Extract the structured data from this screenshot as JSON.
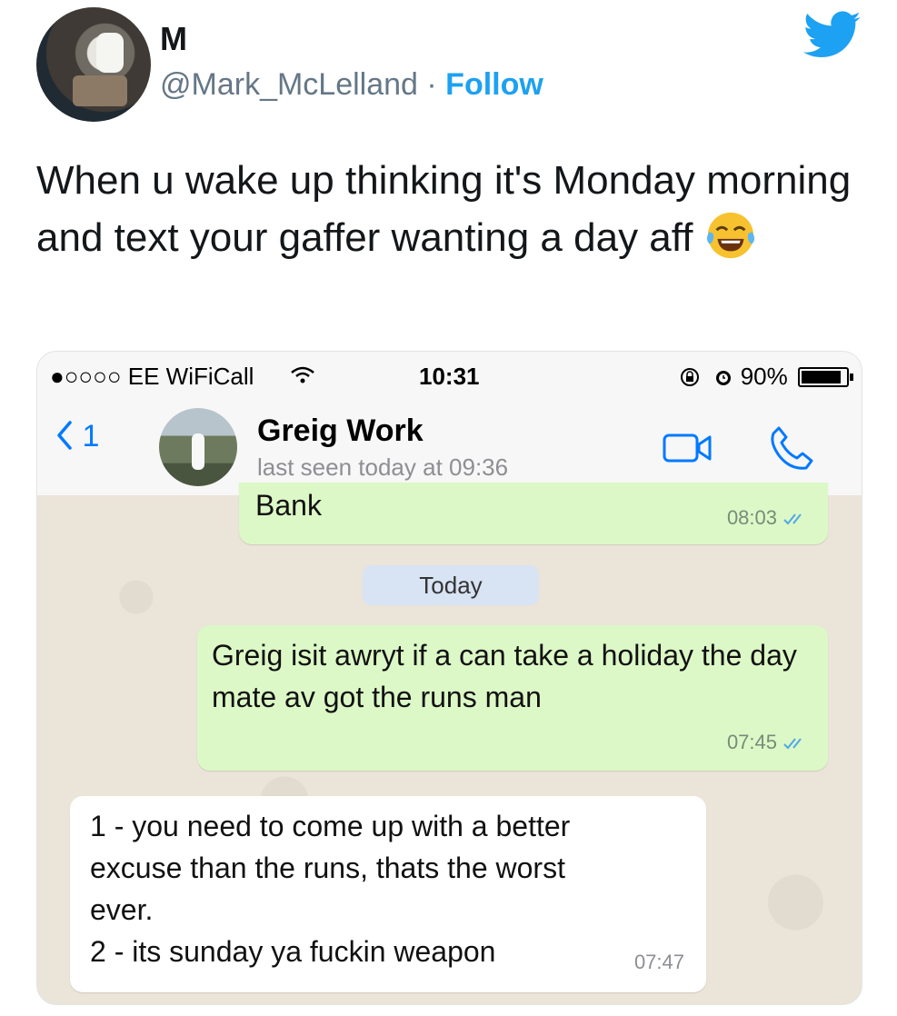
{
  "tweet": {
    "author_name": "M",
    "handle": "@Mark_McLelland",
    "separator": " · ",
    "follow_label": "Follow",
    "text": "When u wake up thinking it's Monday morning and text your gaffer wanting a day aff",
    "emoji": "face-with-tears-of-joy"
  },
  "status_bar": {
    "carrier": "●○○○○ EE WiFiCall",
    "time": "10:31",
    "battery": "90%"
  },
  "chat_header": {
    "back_count": "1",
    "contact_name": "Greig Work",
    "last_seen": "last seen today at 09:36"
  },
  "messages": [
    {
      "direction": "out",
      "text": "Bank",
      "time": "08:03"
    },
    {
      "direction": "out",
      "text": "Greig isit awryt if a can take a holiday the day mate av got the runs man",
      "time": "07:45"
    },
    {
      "direction": "in",
      "lines": [
        "1 - you need to come up with a better",
        "excuse than the runs, thats the worst",
        "ever.",
        "2 - its sunday ya fuckin weapon"
      ],
      "time": "07:47"
    }
  ],
  "day_separator": "Today",
  "colors": {
    "twitter_blue": "#1da1f2",
    "ios_blue": "#0079ff",
    "outgoing_bubble": "#dcf8c6",
    "incoming_bubble": "#ffffff",
    "chat_background": "#ebe4d8"
  }
}
